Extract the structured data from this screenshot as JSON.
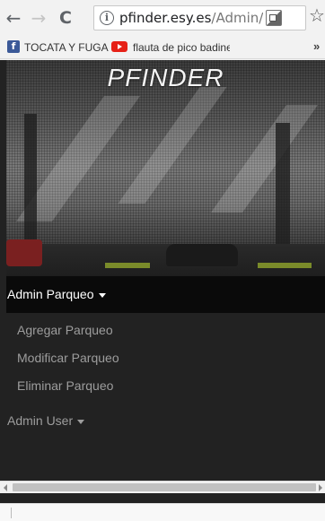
{
  "browser": {
    "url_host": "pfinder.esy.es",
    "url_path": "/Admin/Ad",
    "back_icon": "←",
    "forward_icon": "→",
    "reload_icon": "C",
    "info_icon": "i",
    "star_icon": "☆"
  },
  "bookmarks": {
    "items": [
      {
        "label": "TOCATA Y FUGA",
        "icon": "facebook-icon"
      },
      {
        "label": "flauta de pico badine",
        "icon": "youtube-icon"
      }
    ],
    "overflow": "»"
  },
  "page": {
    "site_title": "PFINDER",
    "admin_parqueo": {
      "label": "Admin Parqueo",
      "items": [
        "Agregar Parqueo",
        "Modificar Parqueo",
        "Eliminar Parqueo"
      ]
    },
    "admin_user": {
      "label": "Admin User"
    }
  }
}
